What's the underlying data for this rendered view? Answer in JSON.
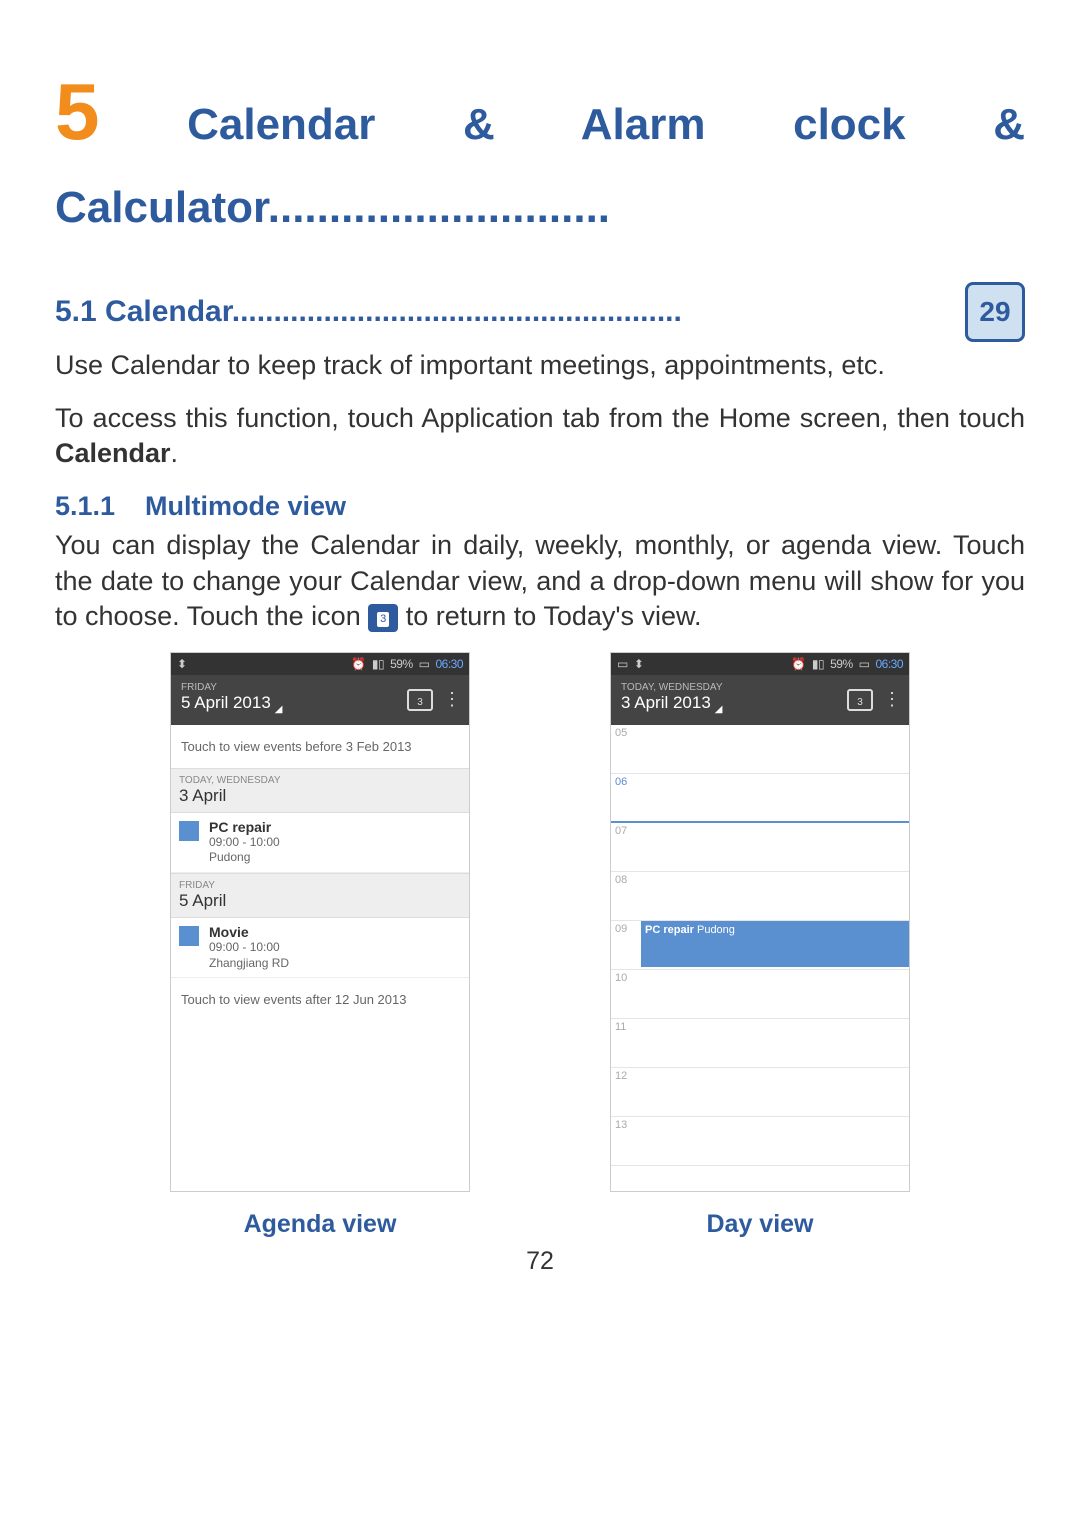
{
  "chapter": {
    "num": "5",
    "title_rest": " Calendar & Alarm clock & Calculator............................"
  },
  "sec51": {
    "label": "5.1  Calendar......................................................",
    "icon": "29"
  },
  "para1": "Use Calendar to keep track of important meetings, appointments, etc.",
  "para2a": "To access this function, touch Application tab from the Home screen, then touch ",
  "para2b": "Calendar",
  "para2c": ".",
  "sec511": {
    "num": "5.1.1",
    "title": "Multimode view"
  },
  "para3a": "You can display the Calendar in daily, weekly, monthly, or agenda view. Touch the date to change your Calendar view, and a drop-down menu will show for you to choose. Touch the icon ",
  "para3b": " to return to Today's view.",
  "inline_icon_num": "3",
  "status": {
    "alarm": "⏰",
    "signal": "▮▯",
    "pct": "59%",
    "batt": "▭",
    "time": "06:30"
  },
  "agenda": {
    "day_sm": "FRIDAY",
    "day_lg": "5 April 2013",
    "today_num": "3",
    "hint_before": "Touch to view events before 3 Feb 2013",
    "group1_sm": "TODAY, WEDNESDAY",
    "group1_lg": "3 April",
    "ev1_title": "PC repair",
    "ev1_time": "09:00 - 10:00",
    "ev1_loc": "Pudong",
    "group2_sm": "FRIDAY",
    "group2_lg": "5 April",
    "ev2_title": "Movie",
    "ev2_time": "09:00 - 10:00",
    "ev2_loc": "Zhangjiang RD",
    "hint_after": "Touch to view events after 12 Jun 2013",
    "caption": "Agenda view"
  },
  "day": {
    "day_sm": "TODAY, WEDNESDAY",
    "day_lg": "3 April 2013",
    "today_num": "3",
    "hours": [
      "05",
      "06",
      "07",
      "08",
      "09",
      "10",
      "11",
      "12",
      "13"
    ],
    "ev_title": "PC repair",
    "ev_loc": "Pudong",
    "caption": "Day view"
  },
  "page_number": "72"
}
